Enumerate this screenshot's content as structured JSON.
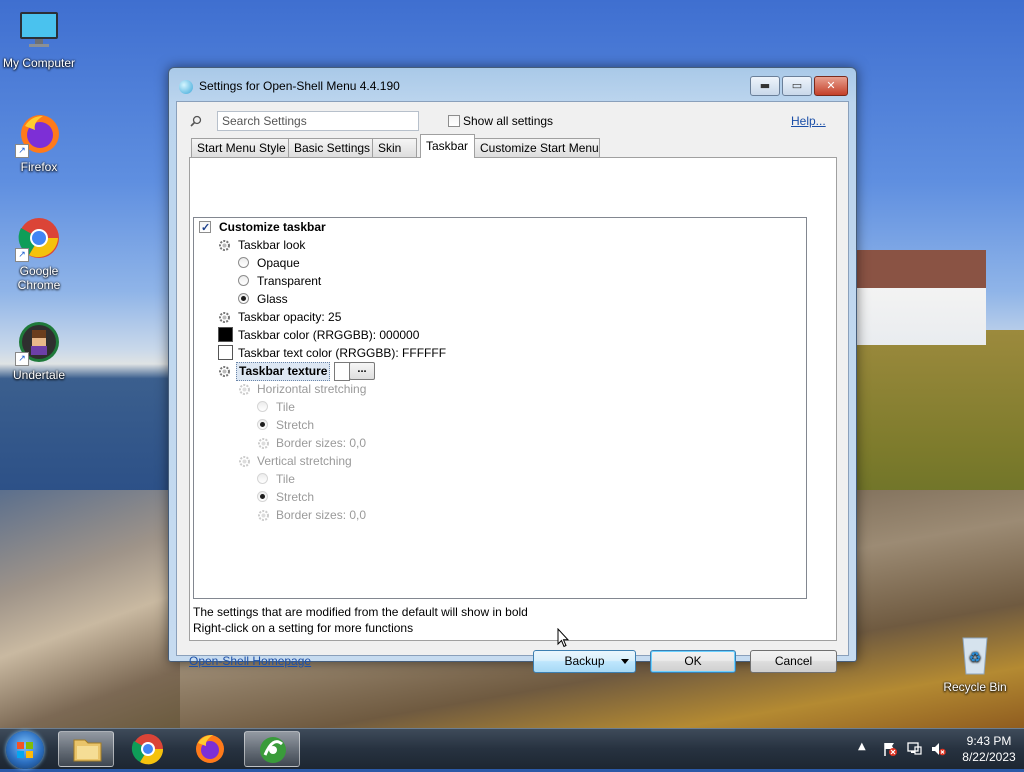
{
  "desktop": {
    "icons": [
      {
        "label": "My Computer"
      },
      {
        "label": "Firefox"
      },
      {
        "label": "Google Chrome"
      },
      {
        "label": "Undertale"
      },
      {
        "label": "Recycle Bin"
      }
    ]
  },
  "window": {
    "title": "Settings for Open-Shell Menu 4.4.190",
    "search_placeholder": "Search Settings",
    "show_all_label": "Show all settings",
    "help_label": "Help...",
    "tabs": [
      {
        "label": "Start Menu Style"
      },
      {
        "label": "Basic Settings"
      },
      {
        "label": "Skin"
      },
      {
        "label": "Taskbar"
      },
      {
        "label": "Customize Start Menu"
      }
    ],
    "active_tab": "Taskbar",
    "tree": {
      "customize_taskbar": "Customize taskbar",
      "taskbar_look": "Taskbar look",
      "opaque": "Opaque",
      "transparent": "Transparent",
      "glass": "Glass",
      "taskbar_opacity": "Taskbar opacity: 25",
      "taskbar_color": "Taskbar color (RRGGBB): 000000",
      "taskbar_text_color": "Taskbar text color (RRGGBB): FFFFFF",
      "taskbar_texture": "Taskbar texture",
      "browse_label": "...",
      "horizontal_stretching": "Horizontal stretching",
      "h_tile": "Tile",
      "h_stretch": "Stretch",
      "h_border": "Border sizes: 0,0",
      "vertical_stretching": "Vertical stretching",
      "v_tile": "Tile",
      "v_stretch": "Stretch",
      "v_border": "Border sizes: 0,0"
    },
    "note_line1": "The settings that are modified from the default will show in bold",
    "note_line2": "Right-click on a setting for more functions",
    "homepage_link": "Open-Shell Homepage",
    "backup_label": "Backup",
    "ok_label": "OK",
    "cancel_label": "Cancel"
  },
  "taskbar": {
    "time": "9:43 PM",
    "date": "8/22/2023"
  },
  "colors": {
    "link": "#1b4fa8",
    "taskbar_color_swatch": "#000000",
    "taskbar_text_color_swatch": "#FFFFFF"
  }
}
